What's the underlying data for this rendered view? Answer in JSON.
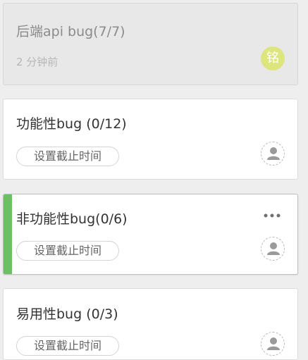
{
  "cards": [
    {
      "title": "后端api bug(7/7)",
      "meta": "2 分钟前",
      "avatar_text": "铭",
      "state": "done"
    },
    {
      "title": "功能性bug (0/12)",
      "deadline_label": "设置截止时间",
      "state": "open"
    },
    {
      "title": "非功能性bug(0/6)",
      "deadline_label": "设置截止时间",
      "state": "active"
    },
    {
      "title": "易用性bug (0/3)",
      "deadline_label": "设置截止时间",
      "state": "open"
    }
  ],
  "icons": {
    "more": "more-horizontal-icon",
    "assignee": "user-placeholder-icon"
  },
  "colors": {
    "accent": "#6cc063",
    "avatar": "#dde67e",
    "background": "#eeeeee"
  }
}
